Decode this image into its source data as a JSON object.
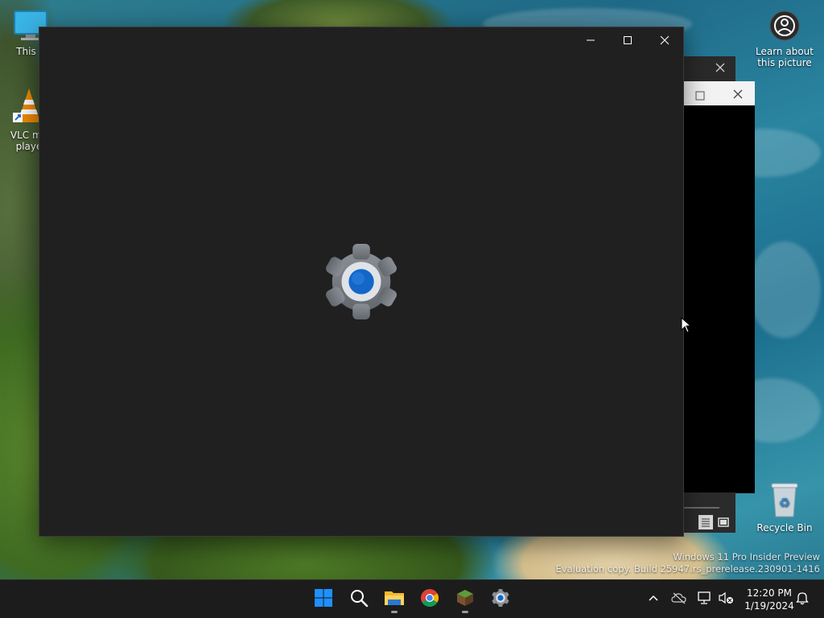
{
  "desktop": {
    "icons": [
      {
        "label": "This PC",
        "display": "This P"
      },
      {
        "label": "VLC media player",
        "line1": "VLC me",
        "line2": "playe"
      },
      {
        "label": "Learn about this picture",
        "line1": "Learn about",
        "line2": "this picture"
      },
      {
        "label": "Recycle Bin"
      }
    ]
  },
  "main_window": {
    "icon": "settings-gear-icon",
    "buttons": {
      "minimize": "minimize-icon",
      "maximize": "maximize-icon",
      "close": "close-icon"
    }
  },
  "watermark": {
    "line1": "Windows 11 Pro Insider Preview",
    "line2": "Evaluation copy. Build 25947.rs_prerelease.230901-1416"
  },
  "taskbar": {
    "apps": [
      {
        "name": "start-icon"
      },
      {
        "name": "search-icon"
      },
      {
        "name": "file-explorer-icon",
        "running": true
      },
      {
        "name": "chrome-icon"
      },
      {
        "name": "minecraft-icon",
        "running": true
      },
      {
        "name": "settings-icon"
      }
    ],
    "tray": {
      "time": "12:20 PM",
      "date": "1/19/2024"
    }
  },
  "colors": {
    "window_bg": "#202020",
    "taskbar_bg": "#1c1c1c",
    "accent": "#0078d4"
  }
}
